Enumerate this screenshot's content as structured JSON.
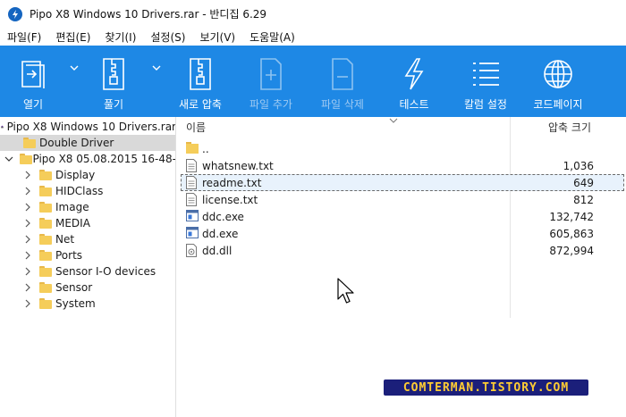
{
  "window": {
    "title": "Pipo X8 Windows 10 Drivers.rar - 반디집 6.29"
  },
  "menu": [
    "파일(F)",
    "편집(E)",
    "찾기(I)",
    "설정(S)",
    "보기(V)",
    "도움말(A)"
  ],
  "toolbar": {
    "open": "열기",
    "extract": "풀기",
    "new_archive": "새로 압축",
    "add_files": "파일 추가",
    "delete_files": "파일 삭제",
    "test": "테스트",
    "column_settings": "칼럼 설정",
    "codepage": "코드페이지"
  },
  "tree": {
    "root": "Pipo X8 Windows 10 Drivers.rar",
    "items": [
      {
        "label": "Double Driver",
        "selected": true
      },
      {
        "label": "Pipo X8 05.08.2015 16-48-"
      },
      {
        "label": "Display"
      },
      {
        "label": "HIDClass"
      },
      {
        "label": "Image"
      },
      {
        "label": "MEDIA"
      },
      {
        "label": "Net"
      },
      {
        "label": "Ports"
      },
      {
        "label": "Sensor I-O devices"
      },
      {
        "label": "Sensor"
      },
      {
        "label": "System"
      }
    ]
  },
  "list": {
    "headers": {
      "name": "이름",
      "size": "압축 크기"
    },
    "rows": [
      {
        "name": "..",
        "size": "",
        "kind": "folder"
      },
      {
        "name": "whatsnew.txt",
        "size": "1,036",
        "kind": "txt"
      },
      {
        "name": "readme.txt",
        "size": "649",
        "kind": "txt",
        "focused": true
      },
      {
        "name": "license.txt",
        "size": "812",
        "kind": "txt"
      },
      {
        "name": "ddc.exe",
        "size": "132,742",
        "kind": "exe"
      },
      {
        "name": "dd.exe",
        "size": "605,863",
        "kind": "exe"
      },
      {
        "name": "dd.dll",
        "size": "872,994",
        "kind": "dll"
      }
    ]
  },
  "watermark": "COMTERMAN.TISTORY.COM",
  "colors": {
    "toolbar": "#1e88e5",
    "selection": "#d9d9d9",
    "folder": "#f5cd5a"
  }
}
